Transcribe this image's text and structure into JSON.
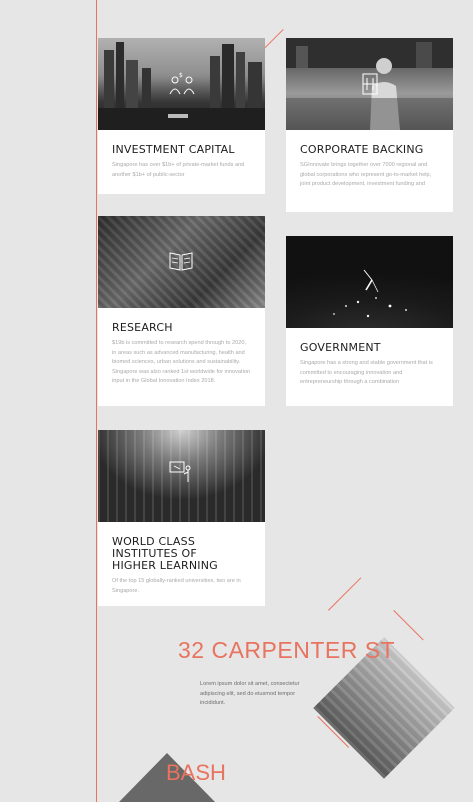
{
  "cards": {
    "investment": {
      "title": "INVESTMENT CAPITAL",
      "body": "Singapore has over $1b+ of private-market funds and another $1b+ of public-sector"
    },
    "corporate": {
      "title": "CORPORATE BACKING",
      "body": "SGInnovate brings together over 7000 regional and global corporations who represent go-to-market help, joint product development, investment funding and"
    },
    "research": {
      "title": "RESEARCH",
      "body": "$19b is committed to research spend through to 2020, in areas such as advanced manufacturing, health and biomed sciences, urban solutions and sustainability. Singapore was also ranked 1st worldwide for innovation input in the Global Innovation Index 2018."
    },
    "government": {
      "title": "GOVERNMENT",
      "body": "Singapore has a strong and stable government that is committed to encouraging innovation and entrepreneurship through a combination"
    },
    "institutes": {
      "title": "WORLD CLASS INSTITUTES OF HIGHER LEARNING",
      "body": "Of the top 15 globally-ranked universities, two are in Singapore."
    }
  },
  "location": {
    "address": "32 CARPENTER ST",
    "description": "Lorem ipsum dolor sit amet, consectetur adipiscing elit, sed do eiusmod tempor incididunt."
  },
  "footer": {
    "label": "BASH"
  },
  "colors": {
    "accent": "#e8735f",
    "background": "#e6e6e6",
    "card": "#ffffff"
  },
  "icons": [
    "people-money-icon",
    "building-icon",
    "book-icon",
    "chevron-network-icon",
    "presentation-icon"
  ]
}
